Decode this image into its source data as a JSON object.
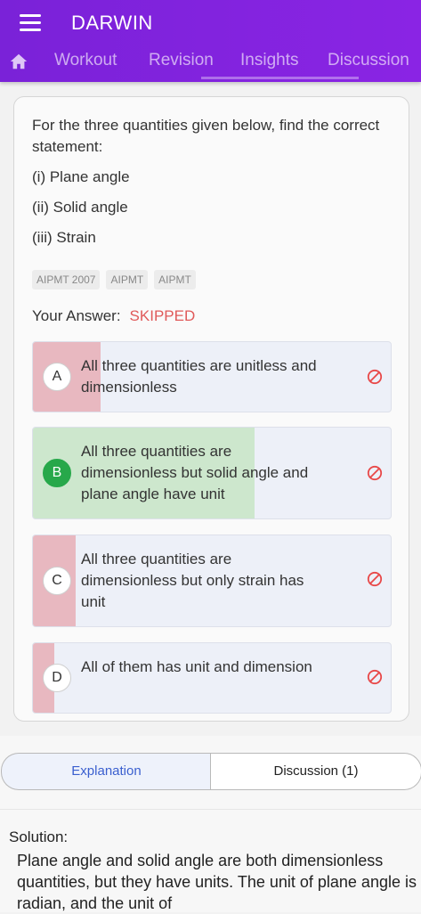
{
  "app": {
    "title": "DARWIN"
  },
  "tabs": [
    {
      "label": "Workout"
    },
    {
      "label": "Revision"
    },
    {
      "label": "Insights"
    },
    {
      "label": "Discussion"
    }
  ],
  "question": {
    "text": "For the three quantities given below, find the correct statement:",
    "items": [
      "(i) Plane angle",
      "(ii) Solid angle",
      "(iii) Strain"
    ],
    "tags": [
      "AIPMT 2007",
      "AIPMT",
      "AIPMT"
    ],
    "your_answer_label": "Your Answer:",
    "your_answer_value": "SKIPPED"
  },
  "options": [
    {
      "letter": "A",
      "text": "All three quantities are unitless and dimensionless",
      "share": 0.19,
      "color": "#e8b8c0",
      "correct": false
    },
    {
      "letter": "B",
      "text": "All three quantities are dimensionless but solid angle and plane angle have unit",
      "share": 0.62,
      "color": "#cde7cd",
      "correct": true
    },
    {
      "letter": "C",
      "text": "All three quantities are dimensionless but only strain has unit",
      "share": 0.12,
      "color": "#e8b8c0",
      "correct": false
    },
    {
      "letter": "D",
      "text": "All of them has unit and dimension",
      "share": 0.06,
      "color": "#e8b8c0",
      "correct": false
    }
  ],
  "bottom": {
    "explanation_label": "Explanation",
    "discussion_label": "Discussion (1)",
    "solution_label": "Solution:",
    "solution_text": "Plane angle and solid angle are both dimensionless quantities, but they have units. The unit of plane angle is radian, and the unit of"
  },
  "colors": {
    "brand": "#8a24e4",
    "skipped": "#e05a5a",
    "correct": "#27a84a",
    "link": "#3a5fcf"
  }
}
